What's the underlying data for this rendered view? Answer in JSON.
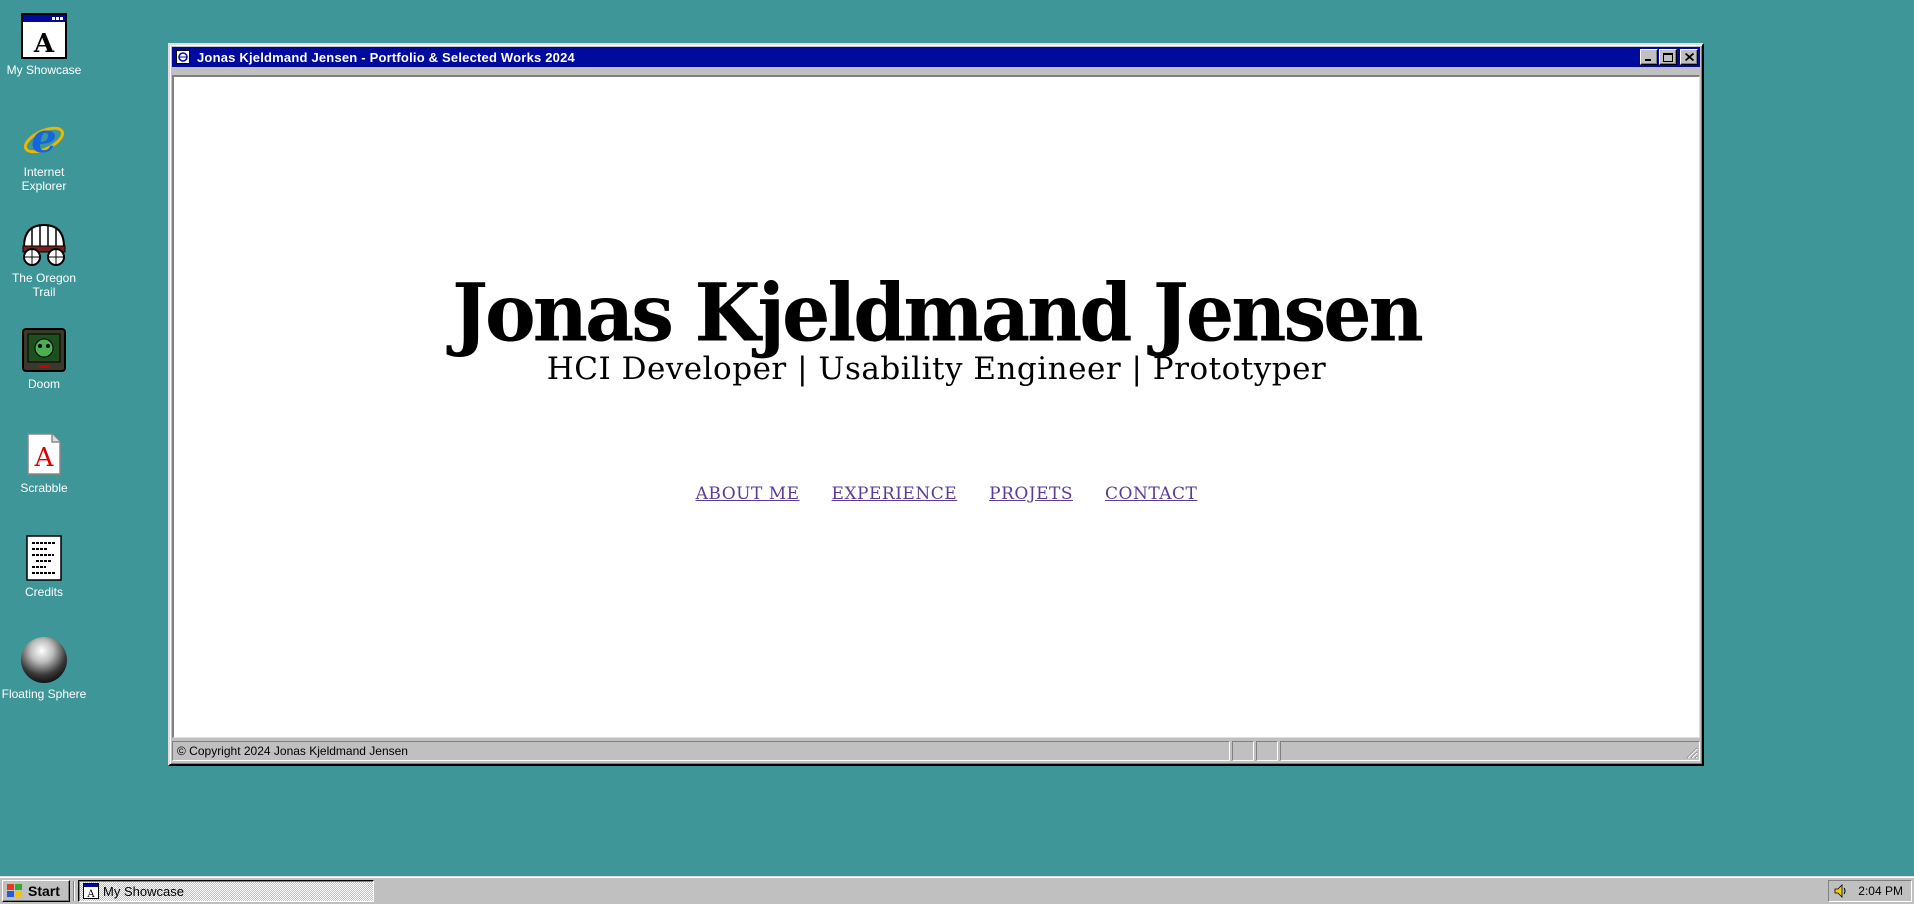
{
  "desktop": {
    "icons": [
      {
        "label": "My Showcase",
        "icon": "showcase-window-icon"
      },
      {
        "label": "Internet Explorer",
        "icon": "internet-explorer-icon"
      },
      {
        "label": "The Oregon Trail",
        "icon": "covered-wagon-icon"
      },
      {
        "label": "Doom",
        "icon": "doom-monitor-icon"
      },
      {
        "label": "Scrabble",
        "icon": "scrabble-tile-icon"
      },
      {
        "label": "Credits",
        "icon": "document-icon"
      },
      {
        "label": "Floating Sphere",
        "icon": "sphere-icon"
      }
    ]
  },
  "window": {
    "title": "Jonas Kjeldmand Jensen - Portfolio & Selected Works 2024",
    "hero": {
      "name": "Jonas Kjeldmand Jensen",
      "tagline": "HCI Developer | Usability Engineer | Prototyper"
    },
    "nav": [
      {
        "label": "ABOUT ME"
      },
      {
        "label": "EXPERIENCE"
      },
      {
        "label": "PROJETS"
      },
      {
        "label": "CONTACT"
      }
    ],
    "status": {
      "text": "© Copyright 2024 Jonas Kjeldmand Jensen"
    }
  },
  "taskbar": {
    "start_label": "Start",
    "task_label": "My Showcase",
    "clock": "2:04 PM"
  },
  "colors": {
    "desktop": "#3e9698",
    "titlebar": "#000a9c",
    "link": "#5a3c95"
  }
}
